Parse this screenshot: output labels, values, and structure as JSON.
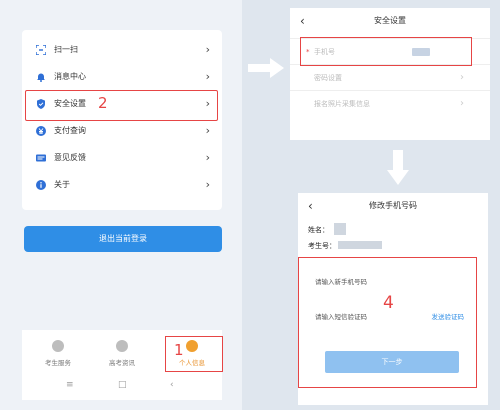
{
  "menu": {
    "items": [
      {
        "label": "扫一扫",
        "icon": "scan-icon"
      },
      {
        "label": "消息中心",
        "icon": "bell-icon"
      },
      {
        "label": "安全设置",
        "icon": "shield-icon"
      },
      {
        "label": "支付查询",
        "icon": "payment-icon"
      },
      {
        "label": "意见反馈",
        "icon": "feedback-icon"
      },
      {
        "label": "关于",
        "icon": "info-icon"
      }
    ],
    "chevron": "›"
  },
  "logout": {
    "label": "退出当前登录"
  },
  "bottom_nav": {
    "items": [
      {
        "label": "考生服务"
      },
      {
        "label": "高考资讯"
      },
      {
        "label": "个人信息"
      }
    ]
  },
  "system_nav": {
    "menu": "≡",
    "home": "□",
    "back": "‹"
  },
  "annotations": {
    "one": "1",
    "two": "2",
    "four": "4"
  },
  "security_panel": {
    "back": "‹",
    "title": "安全设置",
    "rows": [
      {
        "label": "手机号",
        "required_mark": "*"
      },
      {
        "label": "密码设置"
      },
      {
        "label": "报名照片采集信息"
      }
    ]
  },
  "change_panel": {
    "back": "‹",
    "title": "修改手机号码",
    "name_label": "姓名：",
    "exam_no_label": "考生号：",
    "new_phone_placeholder": "请输入新手机号码",
    "code_placeholder": "请输入短信验证码",
    "send_code": "发送验证码",
    "next": "下一步"
  },
  "colors": {
    "accent": "#2f8ee6",
    "highlight": "#e64545",
    "active_nav": "#f0a030"
  }
}
